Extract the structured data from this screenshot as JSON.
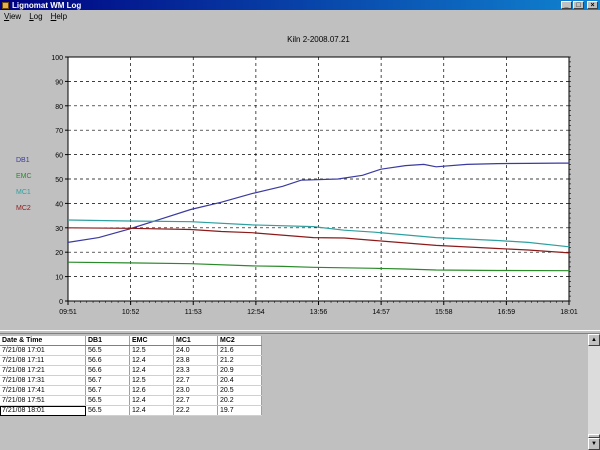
{
  "window": {
    "title": "Lignomat WM Log",
    "controls": {
      "minimize": "_",
      "maximize": "□",
      "close": "×"
    }
  },
  "menu": [
    {
      "label": "View",
      "accel": "V",
      "rest": "iew"
    },
    {
      "label": "Log",
      "accel": "L",
      "rest": "og"
    },
    {
      "label": "Help",
      "accel": "H",
      "rest": "elp"
    }
  ],
  "chart_data": {
    "type": "line",
    "title": "Kiln 2-2008.07.21",
    "xlabel": "",
    "ylabel": "",
    "ylim": [
      0,
      100
    ],
    "y_ticks": [
      0,
      10,
      20,
      30,
      40,
      50,
      60,
      70,
      80,
      90,
      100
    ],
    "x_ticks": [
      "09:51",
      "10:52",
      "11:53",
      "12:54",
      "13:56",
      "14:57",
      "15:58",
      "16:59",
      "18:01"
    ],
    "x_range_hours": [
      0,
      8.1667
    ],
    "grid": true,
    "legend_position": "left",
    "series": [
      {
        "name": "DB1",
        "color": "#3a3aa0",
        "points": [
          [
            0,
            24
          ],
          [
            0.5,
            26
          ],
          [
            1,
            29.5
          ],
          [
            1.5,
            33.5
          ],
          [
            2,
            37.5
          ],
          [
            2.5,
            40.5
          ],
          [
            3,
            44
          ],
          [
            3.5,
            47
          ],
          [
            3.8,
            49.5
          ],
          [
            4.4,
            50
          ],
          [
            4.8,
            51.5
          ],
          [
            5.1,
            54
          ],
          [
            5.5,
            55.5
          ],
          [
            5.8,
            56
          ],
          [
            6,
            55
          ],
          [
            6.5,
            56
          ],
          [
            7,
            56.3
          ],
          [
            7.5,
            56.4
          ],
          [
            8,
            56.5
          ],
          [
            8.17,
            56.5
          ]
        ]
      },
      {
        "name": "EMC",
        "color": "#2a8a2a",
        "points": [
          [
            0,
            15.9
          ],
          [
            1,
            15.6
          ],
          [
            2,
            15.3
          ],
          [
            3,
            14.4
          ],
          [
            3.5,
            14.2
          ],
          [
            4,
            13.8
          ],
          [
            4.5,
            13.6
          ],
          [
            5,
            13.4
          ],
          [
            5.5,
            13.1
          ],
          [
            6,
            12.7
          ],
          [
            7,
            12.5
          ],
          [
            8.17,
            12.4
          ]
        ]
      },
      {
        "name": "MC1",
        "color": "#2f9f9f",
        "points": [
          [
            0,
            33.2
          ],
          [
            1,
            32.8
          ],
          [
            2,
            32.5
          ],
          [
            3,
            31.2
          ],
          [
            4,
            30.5
          ],
          [
            4.5,
            29
          ],
          [
            5,
            28.2
          ],
          [
            6,
            26
          ],
          [
            7,
            24.8
          ],
          [
            7.5,
            24
          ],
          [
            8.17,
            22.2
          ]
        ]
      },
      {
        "name": "MC2",
        "color": "#8b1a1a",
        "points": [
          [
            0,
            30
          ],
          [
            1,
            29.8
          ],
          [
            2,
            29.3
          ],
          [
            2.5,
            28.5
          ],
          [
            3,
            28
          ],
          [
            4,
            26
          ],
          [
            4.5,
            25.8
          ],
          [
            5,
            24.8
          ],
          [
            6,
            22.8
          ],
          [
            7,
            21.5
          ],
          [
            7.5,
            20.9
          ],
          [
            8.17,
            19.7
          ]
        ]
      }
    ]
  },
  "table": {
    "columns": [
      "Date & Time",
      "DB1",
      "EMC",
      "MC1",
      "MC2"
    ],
    "rows": [
      [
        "7/21/08 17:01",
        "56.5",
        "12.5",
        "24.0",
        "21.6"
      ],
      [
        "7/21/08 17:11",
        "56.6",
        "12.4",
        "23.8",
        "21.2"
      ],
      [
        "7/21/08 17:21",
        "56.6",
        "12.4",
        "23.3",
        "20.9"
      ],
      [
        "7/21/08 17:31",
        "56.7",
        "12.5",
        "22.7",
        "20.4"
      ],
      [
        "7/21/08 17:41",
        "56.7",
        "12.6",
        "23.0",
        "20.5"
      ],
      [
        "7/21/08 17:51",
        "56.5",
        "12.4",
        "22.7",
        "20.2"
      ],
      [
        "7/21/08 18:01",
        "56.5",
        "12.4",
        "22.2",
        "19.7"
      ]
    ],
    "selected_row": 6
  },
  "scrollbar": {
    "up_glyph": "▲",
    "down_glyph": "▼"
  }
}
